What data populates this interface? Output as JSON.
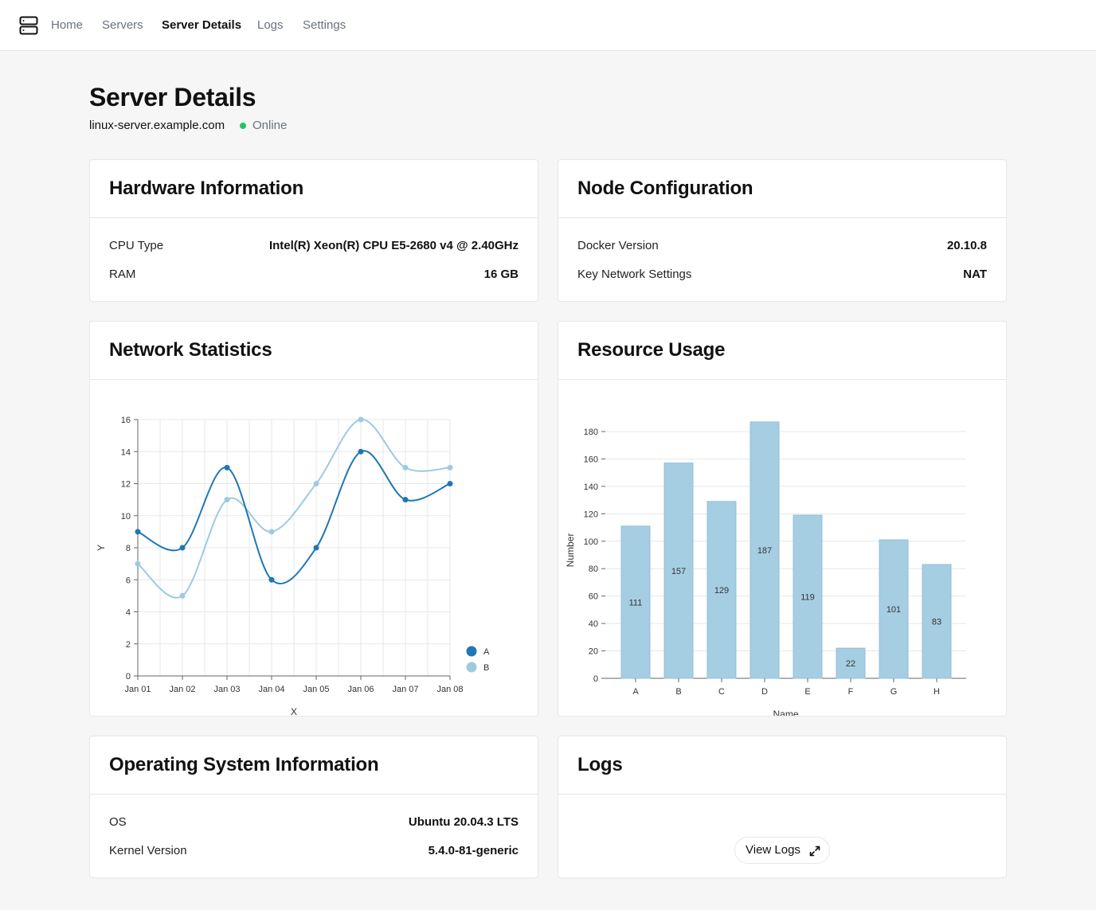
{
  "nav": {
    "logo_icon": "server-icon",
    "items": [
      {
        "label": "Home"
      },
      {
        "label": "Servers"
      },
      {
        "label": "Server Details"
      },
      {
        "label": "Logs"
      },
      {
        "label": "Settings"
      }
    ],
    "active": "Server Details"
  },
  "header": {
    "title": "Server Details",
    "hostname": "linux-server.example.com",
    "status": "Online",
    "status_color": "#22c55e"
  },
  "hardware": {
    "title": "Hardware Information",
    "rows": [
      {
        "label": "CPU Type",
        "value": "Intel(R) Xeon(R) CPU E5-2680 v4 @ 2.40GHz"
      },
      {
        "label": "RAM",
        "value": "16 GB"
      }
    ]
  },
  "node": {
    "title": "Node Configuration",
    "rows": [
      {
        "label": "Docker Version",
        "value": "20.10.8"
      },
      {
        "label": "Key Network Settings",
        "value": "NAT"
      }
    ]
  },
  "network": {
    "title": "Network Statistics"
  },
  "resource": {
    "title": "Resource Usage"
  },
  "os": {
    "title": "Operating System Information",
    "rows": [
      {
        "label": "OS",
        "value": "Ubuntu 20.04.3 LTS"
      },
      {
        "label": "Kernel Version",
        "value": "5.4.0-81-generic"
      }
    ]
  },
  "logs": {
    "title": "Logs",
    "button_label": "View Logs",
    "button_icon": "expand-icon"
  },
  "chart_data": [
    {
      "type": "line",
      "xlabel": "X",
      "ylabel": "Y",
      "x": [
        "Jan 01",
        "Jan 02",
        "Jan 03",
        "Jan 04",
        "Jan 05",
        "Jan 06",
        "Jan 07",
        "Jan 08"
      ],
      "ylim": [
        0,
        16
      ],
      "yticks": [
        0,
        2,
        4,
        6,
        8,
        10,
        12,
        14,
        16
      ],
      "grid": true,
      "legend": "bottom-right",
      "series": [
        {
          "name": "A",
          "color": "#1f77b4",
          "values": [
            9,
            8,
            13,
            6,
            8,
            14,
            11,
            12
          ]
        },
        {
          "name": "B",
          "color": "#9ecae1",
          "values": [
            7,
            5,
            11,
            9,
            12,
            16,
            13,
            13
          ]
        }
      ]
    },
    {
      "type": "bar",
      "xlabel": "Name",
      "ylabel": "Number",
      "categories": [
        "A",
        "B",
        "C",
        "D",
        "E",
        "F",
        "G",
        "H"
      ],
      "values": [
        111,
        157,
        129,
        187,
        119,
        22,
        101,
        83
      ],
      "ylim": [
        0,
        180
      ],
      "yticks": [
        0,
        20,
        40,
        60,
        80,
        100,
        120,
        140,
        160,
        180
      ],
      "color": "#a6cee3",
      "grid": true
    }
  ]
}
